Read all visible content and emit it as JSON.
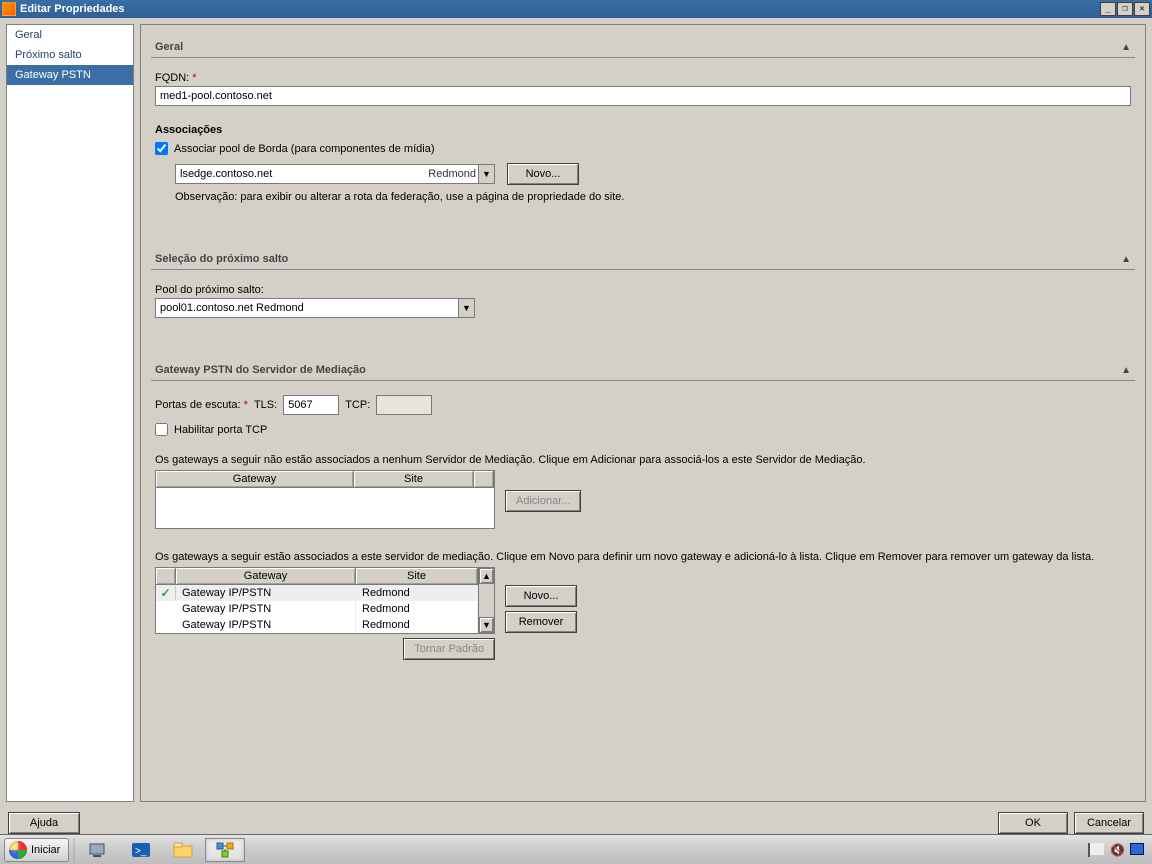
{
  "window": {
    "title": "Editar Propriedades"
  },
  "sidebar": {
    "items": [
      {
        "label": "Geral"
      },
      {
        "label": "Próximo salto"
      },
      {
        "label": "Gateway PSTN"
      }
    ],
    "selected_index": 2
  },
  "sections": {
    "general": {
      "title": "Geral",
      "fqdn_label": "FQDN:",
      "fqdn_value": "med1-pool.contoso.net",
      "assoc_title": "Associações",
      "assoc_checkbox_label": "Associar pool de Borda (para componentes de mídia)",
      "assoc_checked": true,
      "edge_value_left": "lsedge.contoso.net",
      "edge_value_right": "Redmond",
      "new_button": "Novo...",
      "note": "Observação: para exibir ou alterar a rota da federação, use a página de propriedade do site."
    },
    "nexthop": {
      "title": "Seleção do próximo salto",
      "pool_label": "Pool do próximo salto:",
      "pool_value": "pool01.contoso.net   Redmond"
    },
    "pstn": {
      "title": "Gateway PSTN do Servidor de Mediação",
      "ports_label": "Portas de escuta:",
      "tls_label": "TLS:",
      "tls_value": "5067",
      "tcp_label": "TCP:",
      "tcp_value": "",
      "enable_tcp_label": "Habilitar porta TCP",
      "enable_tcp_checked": false,
      "unassoc_text": "Os gateways a seguir não estão associados a nenhum Servidor de Mediação. Clique em Adicionar para associá-los a este Servidor de Mediação.",
      "col_gateway": "Gateway",
      "col_site": "Site",
      "add_button": "Adicionar...",
      "assoc_text": "Os gateways a seguir estão associados a este servidor de mediação. Clique em Novo para definir um novo gateway e adicioná-lo à lista. Clique em Remover para remover um gateway da lista.",
      "assoc_rows": [
        {
          "gateway": "Gateway IP/PSTN",
          "site": "Redmond",
          "default": true
        },
        {
          "gateway": "Gateway IP/PSTN",
          "site": "Redmond",
          "default": false
        },
        {
          "gateway": "Gateway IP/PSTN",
          "site": "Redmond",
          "default": false
        }
      ],
      "new_button": "Novo...",
      "remove_button": "Remover",
      "make_default_button": "Tornar Padrão"
    }
  },
  "footer": {
    "help": "Ajuda",
    "ok": "OK",
    "cancel": "Cancelar"
  },
  "taskbar": {
    "start": "Iniciar"
  }
}
